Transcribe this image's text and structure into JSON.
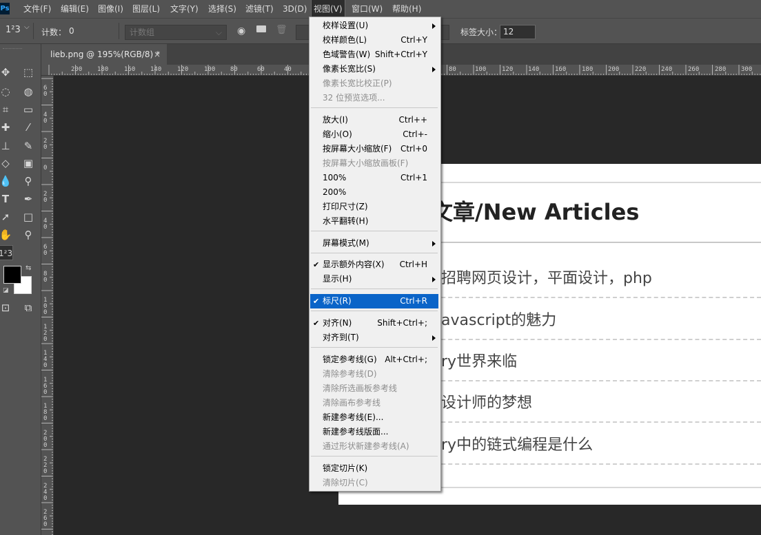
{
  "app": {
    "logo_text": "Ps"
  },
  "menubar": {
    "items": [
      "文件(F)",
      "编辑(E)",
      "图像(I)",
      "图层(L)",
      "文字(Y)",
      "选择(S)",
      "滤镜(T)",
      "3D(D)",
      "视图(V)",
      "窗口(W)",
      "帮助(H)"
    ]
  },
  "options": {
    "tool_icon": "1²3",
    "count_label": "计数：",
    "count_value": "0",
    "group_placeholder": "计数组",
    "label_size_label": "标签大小：",
    "label_size_value": "12"
  },
  "document": {
    "tab_title": "lieb.png @ 195%(RGB/8) *",
    "close_glyph": "×"
  },
  "ruler": {
    "top_labels": [
      "200",
      "180",
      "160",
      "140",
      "120",
      "100",
      "80",
      "60",
      "40",
      "80",
      "100",
      "120",
      "140",
      "160",
      "180",
      "200",
      "220",
      "240",
      "260",
      "280",
      "300"
    ],
    "left_labels": [
      "60",
      "40",
      "20",
      "0",
      "20",
      "40",
      "60",
      "80",
      "100",
      "120",
      "140",
      "160",
      "180",
      "200",
      "220",
      "240",
      "260"
    ]
  },
  "page_content": {
    "heading": "文章/New Articles",
    "articles": [
      "招聘网页设计，平面设计，php",
      "avascript的魅力",
      "ry世界来临",
      "设计师的梦想",
      "ry中的链式编程是什么"
    ]
  },
  "view_menu": {
    "items": [
      {
        "label": "校样设置(U)",
        "shortcut": "",
        "submenu": true
      },
      {
        "label": "校样颜色(L)",
        "shortcut": "Ctrl+Y"
      },
      {
        "label": "色域警告(W)",
        "shortcut": "Shift+Ctrl+Y"
      },
      {
        "label": "像素长宽比(S)",
        "shortcut": "",
        "submenu": true
      },
      {
        "label": "像素长宽比校正(P)",
        "shortcut": "",
        "disabled": true
      },
      {
        "label": "32 位预览选项...",
        "shortcut": "",
        "disabled": true
      },
      {
        "label": "放大(I)",
        "shortcut": "Ctrl++"
      },
      {
        "label": "缩小(O)",
        "shortcut": "Ctrl+-"
      },
      {
        "label": "按屏幕大小缩放(F)",
        "shortcut": "Ctrl+0"
      },
      {
        "label": "按屏幕大小缩放画板(F)",
        "shortcut": "",
        "disabled": true
      },
      {
        "label": "100%",
        "shortcut": "Ctrl+1"
      },
      {
        "label": "200%",
        "shortcut": ""
      },
      {
        "label": "打印尺寸(Z)",
        "shortcut": ""
      },
      {
        "label": "水平翻转(H)",
        "shortcut": ""
      },
      {
        "label": "屏幕模式(M)",
        "shortcut": "",
        "submenu": true
      },
      {
        "label": "显示额外内容(X)",
        "shortcut": "Ctrl+H",
        "checked": true
      },
      {
        "label": "显示(H)",
        "shortcut": "",
        "submenu": true
      },
      {
        "label": "标尺(R)",
        "shortcut": "Ctrl+R",
        "checked": true,
        "selected": true
      },
      {
        "label": "对齐(N)",
        "shortcut": "Shift+Ctrl+;",
        "checked": true
      },
      {
        "label": "对齐到(T)",
        "shortcut": "",
        "submenu": true
      },
      {
        "label": "锁定参考线(G)",
        "shortcut": "Alt+Ctrl+;"
      },
      {
        "label": "清除参考线(D)",
        "shortcut": "",
        "disabled": true
      },
      {
        "label": "清除所选画板参考线",
        "shortcut": "",
        "disabled": true
      },
      {
        "label": "清除画布参考线",
        "shortcut": "",
        "disabled": true
      },
      {
        "label": "新建参考线(E)...",
        "shortcut": ""
      },
      {
        "label": "新建参考线版面...",
        "shortcut": ""
      },
      {
        "label": "通过形状新建参考线(A)",
        "shortcut": "",
        "disabled": true
      },
      {
        "label": "锁定切片(K)",
        "shortcut": ""
      },
      {
        "label": "清除切片(C)",
        "shortcut": "",
        "disabled": true
      }
    ],
    "check_glyph": "✔"
  },
  "colors": {
    "menu_highlight": "#0a64c8",
    "ps_logo_text": "#31a8ff",
    "ui_panel": "#535353",
    "canvas_bg": "#282828"
  },
  "icons": {
    "toolbar": [
      "move-icon",
      "marquee-icon",
      "lasso-icon",
      "quick-select-icon",
      "crop-icon",
      "ruler-tool-icon",
      "healing-icon",
      "brush-icon",
      "clone-stamp-icon",
      "history-brush-icon",
      "eraser-icon",
      "gradient-icon",
      "blur-icon",
      "dodge-icon",
      "type-icon",
      "pen-icon",
      "path-select-icon",
      "rectangle-icon",
      "hand-icon",
      "zoom-icon",
      "count-icon",
      "foreground-color-icon",
      "quick-mask-icon",
      "screen-mode-icon"
    ]
  }
}
